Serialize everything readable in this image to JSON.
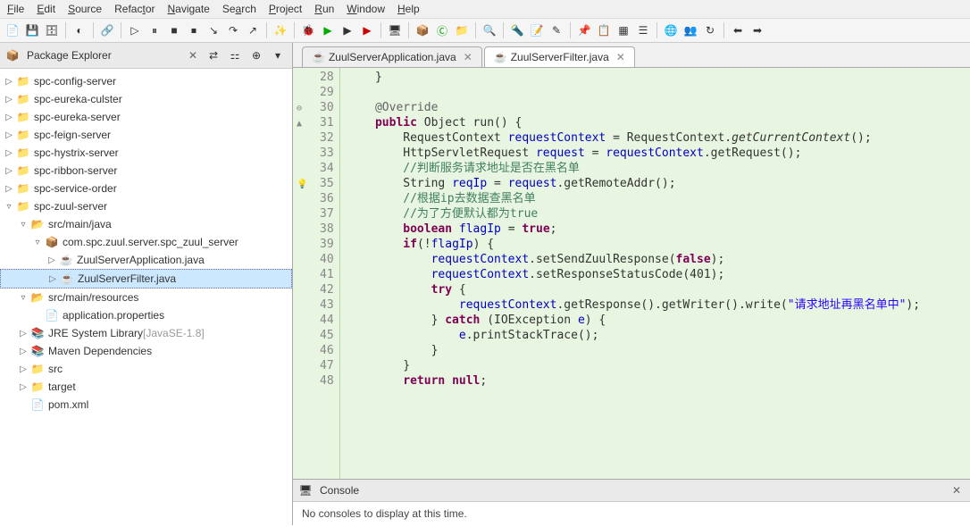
{
  "menu": [
    "File",
    "Edit",
    "Source",
    "Refactor",
    "Navigate",
    "Search",
    "Project",
    "Run",
    "Window",
    "Help"
  ],
  "packageExplorer": {
    "title": "Package Explorer",
    "items": [
      {
        "d": 0,
        "t": "▷",
        "icon": "proj",
        "label": "spc-config-server"
      },
      {
        "d": 0,
        "t": "▷",
        "icon": "proj",
        "label": "spc-eureka-culster"
      },
      {
        "d": 0,
        "t": "▷",
        "icon": "proj",
        "label": "spc-eureka-server"
      },
      {
        "d": 0,
        "t": "▷",
        "icon": "proj",
        "label": "spc-feign-server"
      },
      {
        "d": 0,
        "t": "▷",
        "icon": "proj",
        "label": "spc-hystrix-server"
      },
      {
        "d": 0,
        "t": "▷",
        "icon": "proj",
        "label": "spc-ribbon-server"
      },
      {
        "d": 0,
        "t": "▷",
        "icon": "proj",
        "label": "spc-service-order"
      },
      {
        "d": 0,
        "t": "▿",
        "icon": "proj",
        "label": "spc-zuul-server"
      },
      {
        "d": 1,
        "t": "▿",
        "icon": "srcf",
        "label": "src/main/java"
      },
      {
        "d": 2,
        "t": "▿",
        "icon": "pkg",
        "label": "com.spc.zuul.server.spc_zuul_server"
      },
      {
        "d": 3,
        "t": "▷",
        "icon": "java",
        "label": "ZuulServerApplication.java"
      },
      {
        "d": 3,
        "t": "▷",
        "icon": "java",
        "label": "ZuulServerFilter.java",
        "sel": true
      },
      {
        "d": 1,
        "t": "▿",
        "icon": "srcf",
        "label": "src/main/resources"
      },
      {
        "d": 2,
        "t": "",
        "icon": "file",
        "label": "application.properties"
      },
      {
        "d": 1,
        "t": "▷",
        "icon": "lib",
        "label": "JRE System Library",
        "suffix": "[JavaSE-1.8]"
      },
      {
        "d": 1,
        "t": "▷",
        "icon": "lib",
        "label": "Maven Dependencies"
      },
      {
        "d": 1,
        "t": "▷",
        "icon": "fold",
        "label": "src"
      },
      {
        "d": 1,
        "t": "▷",
        "icon": "fold",
        "label": "target"
      },
      {
        "d": 1,
        "t": "",
        "icon": "xml",
        "label": "pom.xml"
      }
    ]
  },
  "tabs": [
    {
      "label": "ZuulServerApplication.java",
      "active": false
    },
    {
      "label": "ZuulServerFilter.java",
      "active": true
    }
  ],
  "code": {
    "lines": [
      {
        "n": 28,
        "html": "    }"
      },
      {
        "n": 29,
        "html": ""
      },
      {
        "n": 30,
        "marker": "⊖",
        "html": "    <span class='ann'>@Override</span>"
      },
      {
        "n": 31,
        "marker": "▲",
        "html": "    <span class='kw'>public</span> Object run() {"
      },
      {
        "n": 32,
        "html": "        RequestContext <span class='fld'>requestContext</span> = RequestContext.<span class='mth'>getCurrentContext</span>();"
      },
      {
        "n": 33,
        "html": "        HttpServletRequest <span class='fld'>request</span> = <span class='fld'>requestContext</span>.getRequest();"
      },
      {
        "n": 34,
        "html": "        <span class='cmt'>//判断服务请求地址是否在黑名单</span>"
      },
      {
        "n": 35,
        "marker": "💡",
        "html": "        String <span class='fld'>reqIp</span> = <span class='fld'>request</span>.getRemoteAddr();"
      },
      {
        "n": 36,
        "html": "        <span class='cmt'>//根据ip去数据查黑名单</span>"
      },
      {
        "n": 37,
        "html": "        <span class='cmt'>//为了方便默认都为true</span>"
      },
      {
        "n": 38,
        "html": "        <span class='kw'>boolean</span> <span class='fld'>flagIp</span> = <span class='kw'>true</span>;"
      },
      {
        "n": 39,
        "html": "        <span class='kw'>if</span>(!<span class='fld'>flagIp</span>) {"
      },
      {
        "n": 40,
        "html": "            <span class='fld'>requestContext</span>.setSendZuulResponse(<span class='kw'>false</span>);"
      },
      {
        "n": 41,
        "html": "            <span class='fld'>requestContext</span>.setResponseStatusCode(401);"
      },
      {
        "n": 42,
        "html": "            <span class='kw'>try</span> {"
      },
      {
        "n": 43,
        "html": "                <span class='fld'>requestContext</span>.getResponse().getWriter().write(<span class='str'>\"请求地址再黑名单中\"</span>);"
      },
      {
        "n": 44,
        "html": "            } <span class='kw'>catch</span> (IOException <span class='fld'>e</span>) {"
      },
      {
        "n": 45,
        "html": "                <span class='fld'>e</span>.printStackTrace();"
      },
      {
        "n": 46,
        "html": "            }"
      },
      {
        "n": 47,
        "html": "        }"
      },
      {
        "n": 48,
        "html": "        <span class='kw'>return null</span>;"
      }
    ]
  },
  "console": {
    "title": "Console",
    "message": "No consoles to display at this time."
  }
}
